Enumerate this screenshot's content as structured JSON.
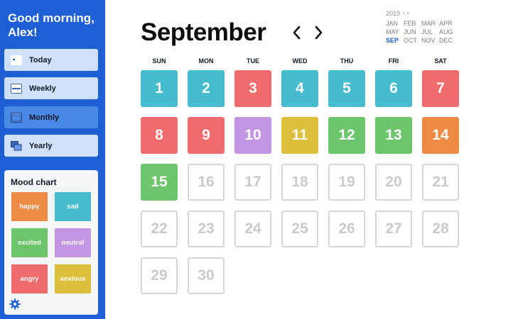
{
  "sidebar": {
    "greeting": "Good morning, Alex!",
    "nav": [
      {
        "label": "Today",
        "icon": "today-icon",
        "active": false
      },
      {
        "label": "Weekly",
        "icon": "weekly-icon",
        "active": false
      },
      {
        "label": "Monthly",
        "icon": "monthly-icon",
        "active": true
      },
      {
        "label": "Yearly",
        "icon": "yearly-icon",
        "active": false
      }
    ],
    "mood_chart": {
      "title": "Mood chart",
      "moods": [
        {
          "label": "happy",
          "color": "#ef8a45"
        },
        {
          "label": "sad",
          "color": "#46bcce"
        },
        {
          "label": "excited",
          "color": "#6cc56a"
        },
        {
          "label": "neutral",
          "color": "#c396e3"
        },
        {
          "label": "angry",
          "color": "#f06b6b"
        },
        {
          "label": "anxious",
          "color": "#ddbf3c"
        }
      ]
    },
    "settings_icon": "gear-icon"
  },
  "calendar": {
    "month": "September",
    "prev_icon": "chevron-left-icon",
    "next_icon": "chevron-right-icon",
    "weekdays": [
      "SUN",
      "MON",
      "TUE",
      "WED",
      "THU",
      "FRI",
      "SAT"
    ],
    "first_weekday_index": 0,
    "days": [
      {
        "day": "1",
        "mood": "sad"
      },
      {
        "day": "2",
        "mood": "sad"
      },
      {
        "day": "3",
        "mood": "angry"
      },
      {
        "day": "4",
        "mood": "sad"
      },
      {
        "day": "5",
        "mood": "sad"
      },
      {
        "day": "6",
        "mood": "sad"
      },
      {
        "day": "7",
        "mood": "angry"
      },
      {
        "day": "8",
        "mood": "angry"
      },
      {
        "day": "9",
        "mood": "angry"
      },
      {
        "day": "10",
        "mood": "neutral"
      },
      {
        "day": "11",
        "mood": "anxious"
      },
      {
        "day": "12",
        "mood": "excited"
      },
      {
        "day": "13",
        "mood": "excited"
      },
      {
        "day": "14",
        "mood": "happy"
      },
      {
        "day": "15",
        "mood": "excited"
      },
      {
        "day": "16",
        "mood": null
      },
      {
        "day": "17",
        "mood": null
      },
      {
        "day": "18",
        "mood": null
      },
      {
        "day": "19",
        "mood": null
      },
      {
        "day": "20",
        "mood": null
      },
      {
        "day": "21",
        "mood": null
      },
      {
        "day": "22",
        "mood": null
      },
      {
        "day": "23",
        "mood": null
      },
      {
        "day": "24",
        "mood": null
      },
      {
        "day": "25",
        "mood": null
      },
      {
        "day": "26",
        "mood": null
      },
      {
        "day": "27",
        "mood": null
      },
      {
        "day": "28",
        "mood": null
      },
      {
        "day": "29",
        "mood": null
      },
      {
        "day": "30",
        "mood": null
      }
    ]
  },
  "mini_nav": {
    "year": "2019",
    "arrows": "‹ ›",
    "months": [
      "JAN",
      "FEB",
      "MAR",
      "APR",
      "MAY",
      "JUN",
      "JUL",
      "AUG",
      "SEP",
      "OCT",
      "NOV",
      "DEC"
    ],
    "current": "SEP"
  }
}
